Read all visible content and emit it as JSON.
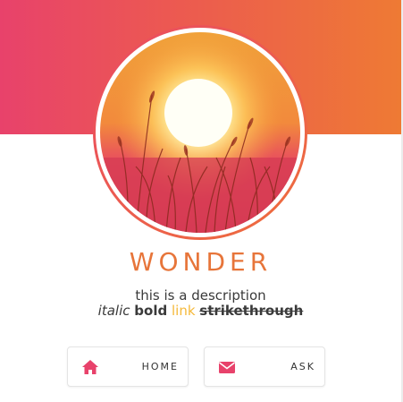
{
  "header": {
    "gradient_start": "#e8426b",
    "gradient_end": "#ee7a34"
  },
  "avatar": {
    "icon": "sunset-photo"
  },
  "blog": {
    "title": "WONDER",
    "title_color": "#e7753a",
    "description_line1": "this is a description",
    "italic": "italic",
    "bold": "bold",
    "link": "link",
    "link_color": "#f5b93a",
    "strike": "strikethrough"
  },
  "nav": {
    "home_label": "HOME",
    "home_icon": "home-icon",
    "ask_label": "ASK",
    "ask_icon": "envelope-icon",
    "icon_color": "#e8426b"
  }
}
